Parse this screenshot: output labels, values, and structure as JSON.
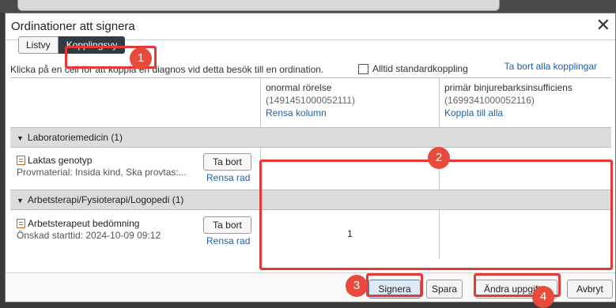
{
  "dialog": {
    "title": "Ordinationer att signera",
    "close_glyph": "✕"
  },
  "views": {
    "list_label": "Listvy",
    "link_label": "Kopplingsvy"
  },
  "hint": {
    "text": "Klicka på en cell för att koppla en diagnos vid detta besök till en ordination.",
    "standard_label": "Alltid standardkoppling",
    "remove_all": "Ta bort alla kopplingar"
  },
  "columns": [
    {
      "name": "onormal rörelse",
      "code": "(1491451000052111)",
      "action": "Rensa kolumn"
    },
    {
      "name": "primär binjurebarksinsufficiens",
      "code": "(1699341000052116)",
      "action": "Koppla till alla"
    }
  ],
  "groups": [
    {
      "label": "Laboratoriemedicin (1)",
      "rows": [
        {
          "name": "Laktas genotyp",
          "detail": "Provmaterial: Insida kind, Ska provtas:...",
          "remove": "Ta bort",
          "clear": "Rensa rad",
          "cells": [
            "",
            ""
          ]
        }
      ]
    },
    {
      "label": "Arbetsterapi/Fysioterapi/Logopedi (1)",
      "rows": [
        {
          "name": "Arbetsterapeut bedömning",
          "detail": "Önskad starttid: 2024-10-09 09:12",
          "remove": "Ta bort",
          "clear": "Rensa rad",
          "cells": [
            "1",
            ""
          ]
        }
      ]
    }
  ],
  "footer": {
    "sign": "Signera",
    "save": "Spara",
    "change": "Ändra uppgifter",
    "cancel": "Avbryt"
  },
  "callouts": [
    "1",
    "2",
    "3",
    "4"
  ],
  "icons": {
    "group_caret": "caret-down-icon",
    "order_icon": "order-document-icon",
    "close": "close-icon"
  },
  "colors": {
    "highlight": "#e53935",
    "badge": "#e84b3c",
    "active_tab": "#2f3b45",
    "link": "#1f5fa8"
  }
}
